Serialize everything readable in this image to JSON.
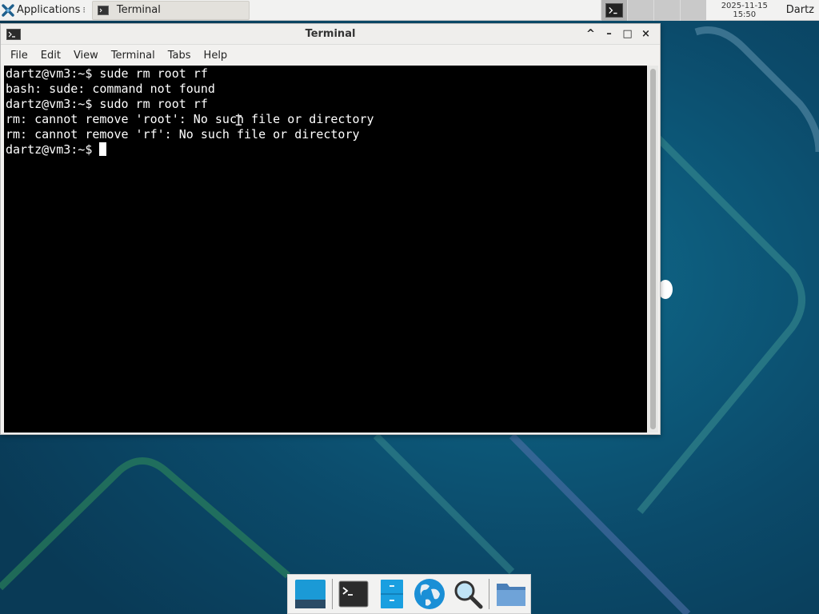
{
  "panel": {
    "applications_label": "Applications",
    "task_label": "Terminal",
    "clock_date": "2025-11-15",
    "clock_time": "15:50",
    "user": "Dartz"
  },
  "window": {
    "title": "Terminal",
    "controls": {
      "shade": "^",
      "minimize": "–",
      "maximize": "□",
      "close": "×"
    }
  },
  "menu": [
    "File",
    "Edit",
    "View",
    "Terminal",
    "Tabs",
    "Help"
  ],
  "terminal": {
    "lines": [
      "dartz@vm3:~$ sude rm root rf",
      "bash: sude: command not found",
      "dartz@vm3:~$ sudo rm root rf",
      "rm: cannot remove 'root': No such file or directory",
      "rm: cannot remove 'rf': No such file or directory"
    ],
    "prompt": "dartz@vm3:~$ "
  },
  "dock": {
    "items": [
      "show-desktop",
      "terminal",
      "file-manager",
      "web-browser",
      "app-finder",
      "folder"
    ]
  },
  "colors": {
    "wallpaper": "#0b4a6a",
    "terminal_bg": "#000000",
    "terminal_fg": "#ffffff"
  }
}
